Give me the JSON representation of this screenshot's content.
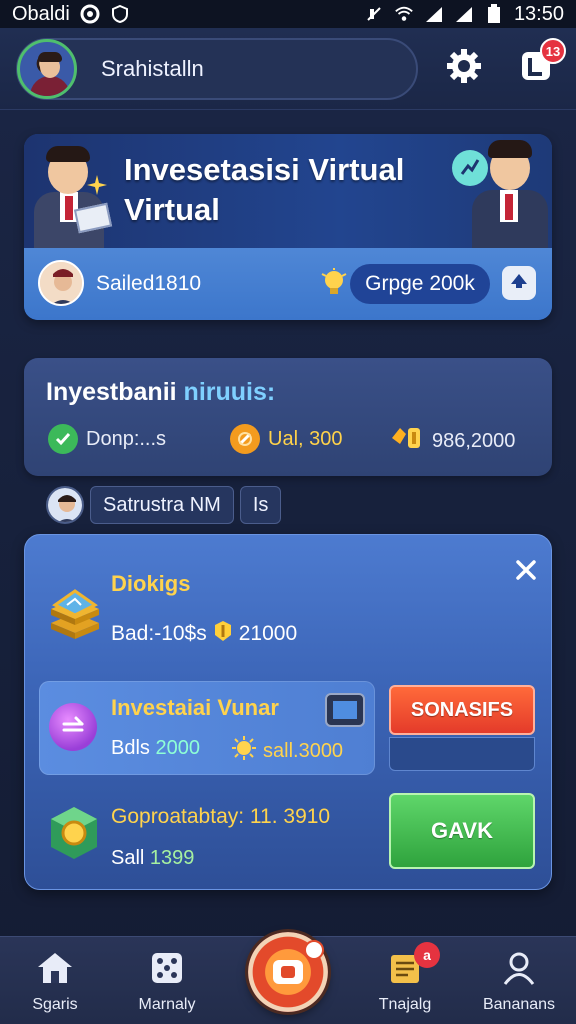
{
  "status_bar": {
    "carrier": "Obaldi",
    "time": "13:50",
    "icons": [
      "circle-icon",
      "shield-icon",
      "mute-icon",
      "wifi-icon",
      "signal-icon",
      "signal-icon",
      "battery-icon"
    ]
  },
  "header": {
    "user_name": "Srahistalln",
    "settings_icon": "gear-icon",
    "notifications_icon": "notification-icon",
    "notification_count": "13"
  },
  "hero": {
    "title_line1": "Invesetasisi Virtual",
    "title_line2": "Virtual",
    "sold_text": "Sailed1810",
    "grade_label": "Grpge 200k",
    "upgrade_icon": "arrow-up-icon"
  },
  "summary": {
    "title_main": "Inyestbanii",
    "title_accent": "niruuis:",
    "stat_1": "Donp:...s",
    "stat_2": "Ual, 300",
    "stat_3": "986,2000"
  },
  "chip_row": {
    "label": "Satrustra NM",
    "suffix": "Is"
  },
  "panel": {
    "section1_title": "Diokigs",
    "section1_value_prefix": "Bad:-10$s",
    "section1_value_suffix": "21000",
    "row2_title": "Investaiai Vunar",
    "row2_a_label": "Bdls",
    "row2_a_value": "2000",
    "row2_b_value": "sall.3000",
    "orange_button": "SONASIFS",
    "section3_title": "Goproatabtay: 11. 3910",
    "section3_label": "Sall",
    "section3_value": "1399",
    "green_button": "GAVK"
  },
  "bottom_nav": {
    "items": [
      {
        "label": "Sgaris",
        "icon": "home-icon"
      },
      {
        "label": "Marnaly",
        "icon": "dice-icon"
      },
      {
        "label": "",
        "icon": "play-icon"
      },
      {
        "label": "Tnajalg",
        "icon": "document-icon"
      },
      {
        "label": "Bananans",
        "icon": "user-icon"
      }
    ],
    "trading_badge": "a"
  },
  "colors": {
    "accent_gold": "#ffd34d",
    "button_orange": "#e43b2a",
    "button_green": "#2fa33d",
    "badge_red": "#e53340"
  }
}
